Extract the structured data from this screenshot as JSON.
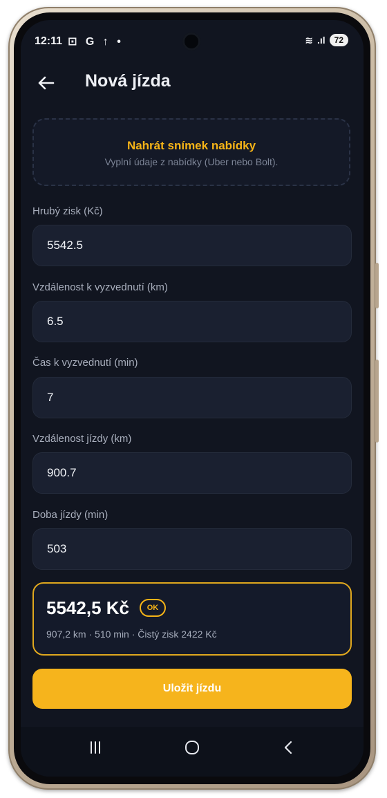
{
  "status_bar": {
    "time": "12:11",
    "left_icons": "⊡ G ↑ •",
    "wifi": "≋",
    "signal": ".ıl",
    "battery": "72"
  },
  "header": {
    "title": "Nová jízda",
    "back_icon": "arrow-left-icon"
  },
  "upload": {
    "title": "Nahrát snímek nabídky",
    "subtitle": "Vyplní údaje z nabídky (Uber nebo Bolt)."
  },
  "fields": [
    {
      "label": "Hrubý zisk (Kč)",
      "value": "5542.5"
    },
    {
      "label": "Vzdálenost k vyzvednutí (km)",
      "value": "6.5"
    },
    {
      "label": "Čas k vyzvednutí (min)",
      "value": "7"
    },
    {
      "label": "Vzdálenost jízdy (km)",
      "value": "900.7"
    },
    {
      "label": "Doba jízdy (min)",
      "value": "503"
    }
  ],
  "result": {
    "amount": "5542,5 Kč",
    "badge": "OK",
    "details": "907,2 km · 510 min · Čistý zisk 2422 Kč"
  },
  "save_label": "Uložit jízdu",
  "colors": {
    "accent": "#f6b41c",
    "background": "#111520",
    "card": "#1a2030"
  },
  "nav": {
    "recents_icon": "recents-icon",
    "home_icon": "home-icon",
    "back_icon": "back-icon"
  }
}
